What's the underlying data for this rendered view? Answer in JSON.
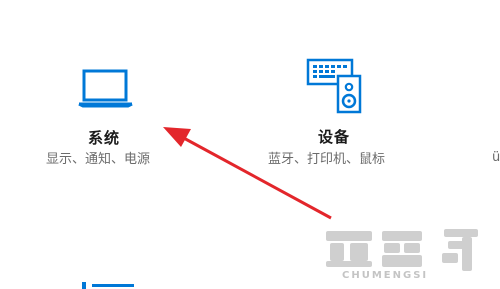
{
  "colors": {
    "accent_blue": "#0078d7",
    "arrow_red": "#e3262b",
    "title_text": "#1a1a1a",
    "subtitle_text": "#6b6b6b",
    "watermark": "#c9c9c9"
  },
  "tiles": [
    {
      "icon": "laptop-icon",
      "title": "系统",
      "subtitle": "显示、通知、电源"
    },
    {
      "icon": "devices-icon",
      "title": "设备",
      "subtitle": "蓝牙、打印机、鼠标"
    }
  ],
  "partial_right_text": "ü",
  "watermark": {
    "logo_glyphs": "楚梦司",
    "brand": "CHUMENGSI"
  }
}
